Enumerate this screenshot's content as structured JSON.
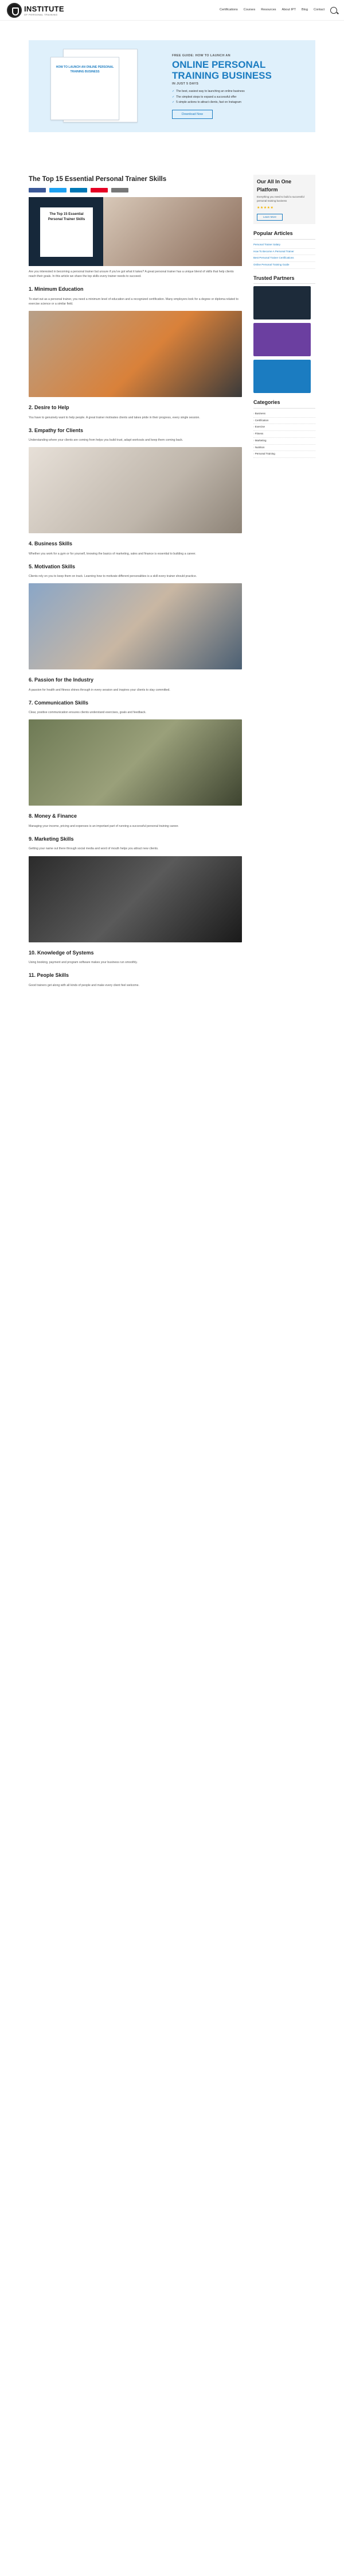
{
  "brand": {
    "name": "INSTITUTE",
    "sub": "OF PERSONAL TRAINING"
  },
  "nav": [
    "Certifications",
    "Courses",
    "Resources",
    "About IPT",
    "Blog",
    "Contact"
  ],
  "promo": {
    "kicker": "FREE GUIDE: HOW TO LAUNCH AN",
    "title": "ONLINE PERSONAL TRAINING BUSINESS",
    "sub": "IN JUST 5 DAYS",
    "bullets": [
      "The best, easiest way to launching an online business",
      "The simplest steps to expand a successful offer",
      "5 simple actions to attract clients, fast on Instagram"
    ],
    "button": "Download Now",
    "book_title": "HOW TO LAUNCH AN ONLINE PERSONAL TRAINING BUSINESS"
  },
  "post": {
    "title": "The Top 15 Essential Personal Trainer Skills",
    "hero_card": "The Top 15 Essential Personal Trainer Skills",
    "intro": "Are you interested in becoming a personal trainer but unsure if you've got what it takes? A great personal trainer has a unique blend of skills that help clients reach their goals. In this article we share the top skills every trainer needs to succeed.",
    "sections": [
      {
        "h": "1. Minimum Education",
        "p": "To start out as a personal trainer, you need a minimum level of education and a recognized certification. Many employers look for a degree or diploma related to exercise science or a similar field."
      },
      {
        "h": "2. Desire to Help",
        "p": "You have to genuinely want to help people. A great trainer motivates clients and takes pride in their progress, every single session."
      },
      {
        "h": "3. Empathy for Clients",
        "p": "Understanding where your clients are coming from helps you build trust, adapt workouts and keep them coming back."
      },
      {
        "h": "4. Business Skills",
        "p": "Whether you work for a gym or for yourself, knowing the basics of marketing, sales and finance is essential to building a career."
      },
      {
        "h": "5. Motivation Skills",
        "p": "Clients rely on you to keep them on track. Learning how to motivate different personalities is a skill every trainer should practice."
      },
      {
        "h": "6. Passion for the Industry",
        "p": "A passion for health and fitness shines through in every session and inspires your clients to stay committed."
      },
      {
        "h": "7. Communication Skills",
        "p": "Clear, positive communication ensures clients understand exercises, goals and feedback."
      },
      {
        "h": "8. Money & Finance",
        "p": "Managing your income, pricing and expenses is an important part of running a successful personal training career."
      },
      {
        "h": "9. Marketing Skills",
        "p": "Getting your name out there through social media and word of mouth helps you attract new clients."
      },
      {
        "h": "10. Knowledge of Systems",
        "p": "Using booking, payment and program software makes your business run smoothly."
      },
      {
        "h": "11. People Skills",
        "p": "Good trainers get along with all kinds of people and make every client feel welcome."
      }
    ]
  },
  "sidebar": {
    "box_title": "Our All In One Platform",
    "box_text": "Everything you need to build a successful personal training business",
    "stars": "★★★★★",
    "box_btn": "Learn More",
    "popular_title": "Popular Articles",
    "popular": [
      "Personal Trainer Salary",
      "How To Become A Personal Trainer",
      "Best Personal Trainer Certifications",
      "Online Personal Training Guide"
    ],
    "partners_title": "Trusted Partners",
    "categories_title": "Categories",
    "categories": [
      "Business",
      "Certification",
      "Exercise",
      "Fitness",
      "Marketing",
      "Nutrition",
      "Personal Training"
    ]
  }
}
